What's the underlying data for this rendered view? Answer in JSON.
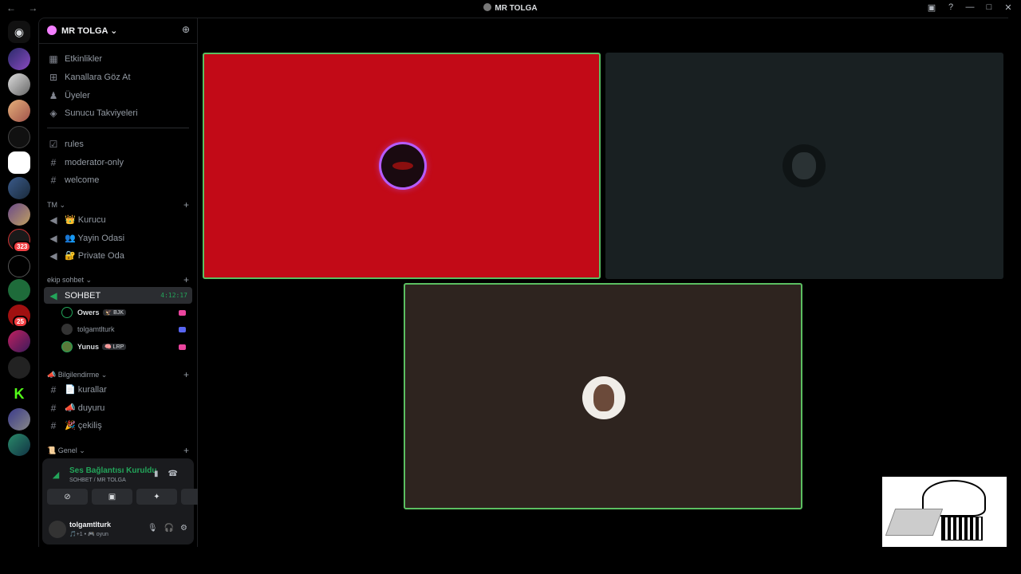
{
  "window": {
    "title": "MR TOLGA",
    "nav_glyphs": "← →",
    "right_icons": [
      "inbox-icon",
      "help-icon",
      "minimize-icon",
      "maximize-icon",
      "close-icon"
    ]
  },
  "rail": {
    "badges": {
      "s9": "323",
      "s11": "25"
    }
  },
  "server": {
    "name": "MR TOLGA",
    "invite_icon": "add-member-icon"
  },
  "top_items": [
    {
      "icon": "calendar-icon",
      "label": "Etkinlikler"
    },
    {
      "icon": "browse-icon",
      "label": "Kanallara Göz At"
    },
    {
      "icon": "members-icon",
      "label": "Üyeler"
    },
    {
      "icon": "boost-icon",
      "label": "Sunucu Takviyeleri"
    }
  ],
  "channels_a": [
    {
      "icon": "rules-icon",
      "label": "rules"
    },
    {
      "icon": "hash-icon",
      "label": "moderator-only"
    },
    {
      "icon": "hash-icon",
      "label": "welcome"
    }
  ],
  "cat_tm": "TM",
  "channels_tm": [
    {
      "icon": "speaker-icon",
      "label": "👑 Kurucu"
    },
    {
      "icon": "speaker-icon",
      "label": "👥 Yayin Odasi"
    },
    {
      "icon": "speaker-icon",
      "label": "🔐 Private Oda"
    }
  ],
  "cat_ekip": "ekip sohbet",
  "active_voice": {
    "label": "SOHBET",
    "timer": "4:12:17"
  },
  "voice_users": [
    {
      "name": "Owers",
      "tag": "🦅 BJK",
      "status": "pink"
    },
    {
      "name": "tolgamtlturk",
      "tag": "",
      "status": "blue"
    },
    {
      "name": "Yunus",
      "tag": "🧠 LRP",
      "status": "pink"
    }
  ],
  "cat_bilgi": "📣 Bilgilendirme",
  "channels_bilgi": [
    {
      "icon": "hash-icon",
      "label": "📄 kurallar"
    },
    {
      "icon": "hash-icon",
      "label": "📣 duyuru"
    },
    {
      "icon": "hash-icon",
      "label": "🎉 çekiliş"
    }
  ],
  "cat_genel": "📜 Genel",
  "voice_panel": {
    "status": "Ses Bağlantısı Kuruldu",
    "sub": "SOHBET / MR TOLGA",
    "buttons": [
      "camera-off-icon",
      "screen-share-icon",
      "activities-icon",
      "soundboard-icon"
    ]
  },
  "user_panel": {
    "name": "tolgamtlturk",
    "sub": "🎵+1 • 🎮 oyun"
  },
  "tiles": [
    {
      "name": "tile-1",
      "bg": "#c20a17"
    },
    {
      "name": "tile-2",
      "bg": "#192022"
    },
    {
      "name": "tile-3",
      "bg": "#2e241f"
    }
  ]
}
